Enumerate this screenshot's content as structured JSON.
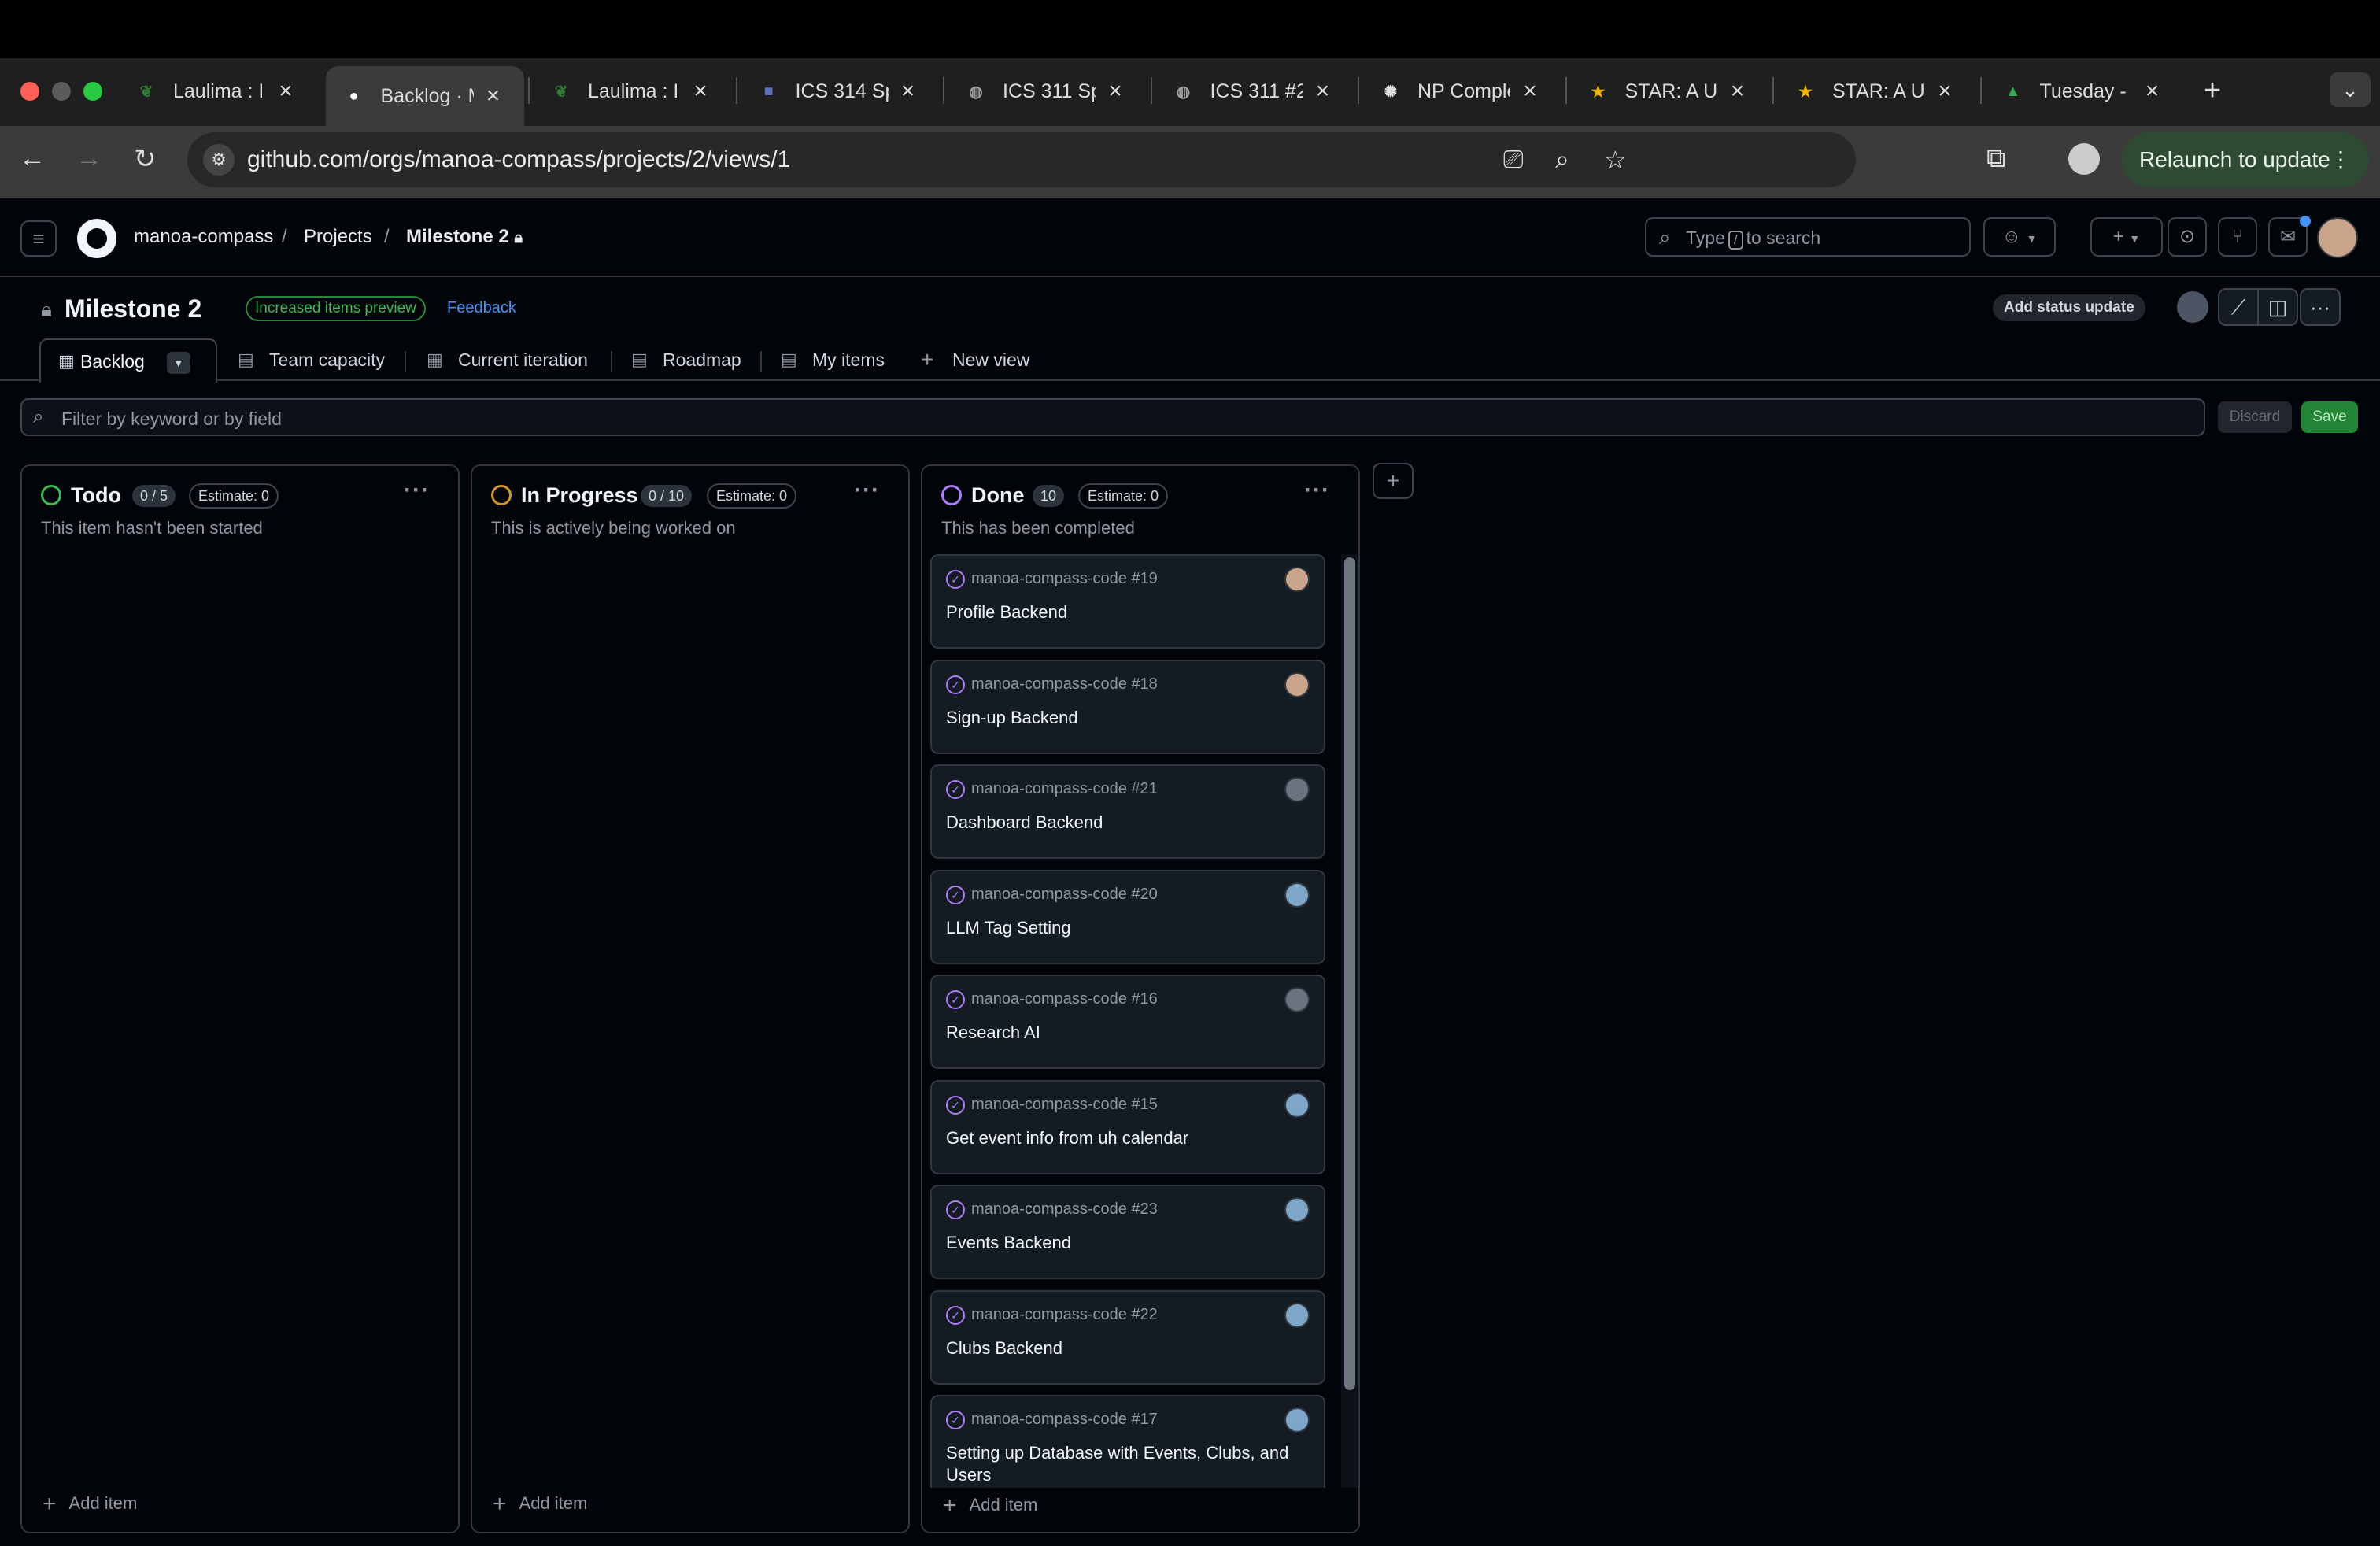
{
  "browser": {
    "tabs": [
      {
        "title": "Laulima : I",
        "favicon": "laulima-leaf-icon",
        "color": "#2e7d32"
      },
      {
        "title": "Backlog · M",
        "favicon": "github-icon",
        "color": "#ffffff"
      },
      {
        "title": "Laulima : I",
        "favicon": "laulima-leaf-icon",
        "color": "#2e7d32"
      },
      {
        "title": "ICS 314 Sp",
        "favicon": "square-icon",
        "color": "#5b6fb5"
      },
      {
        "title": "ICS 311 Sp",
        "favicon": "globe-icon",
        "color": "#9e9e9e"
      },
      {
        "title": "ICS 311 #2",
        "favicon": "globe-icon",
        "color": "#9e9e9e"
      },
      {
        "title": "NP Comple",
        "favicon": "openai-icon",
        "color": "#e0e0e0"
      },
      {
        "title": "STAR: A U",
        "favicon": "star-icon",
        "color": "#f4b400"
      },
      {
        "title": "STAR: A U",
        "favicon": "star-icon",
        "color": "#f4b400"
      },
      {
        "title": "Tuesday -",
        "favicon": "drive-icon",
        "color": "#34a853"
      }
    ],
    "url": "github.com/orgs/manoa-compass/projects/2/views/1",
    "relaunch_label": "Relaunch to update"
  },
  "github_header": {
    "breadcrumbs": [
      "manoa-compass",
      "Projects",
      "Milestone 2"
    ],
    "search_placeholder_pre": "Type",
    "search_key": "/",
    "search_placeholder_post": "to search"
  },
  "project": {
    "title": "Milestone 2",
    "preview_badge": "Increased items preview",
    "feedback_label": "Feedback",
    "status_button": "Add status update"
  },
  "views": {
    "tabs": [
      {
        "label": "Backlog",
        "icon": "board-icon",
        "active": true
      },
      {
        "label": "Team capacity",
        "icon": "table-icon"
      },
      {
        "label": "Current iteration",
        "icon": "board-icon"
      },
      {
        "label": "Roadmap",
        "icon": "roadmap-icon"
      },
      {
        "label": "My items",
        "icon": "table-icon"
      },
      {
        "label": "New view",
        "icon": "plus-icon"
      }
    ]
  },
  "filter": {
    "placeholder": "Filter by keyword or by field",
    "discard_label": "Discard",
    "save_label": "Save"
  },
  "columns": [
    {
      "name": "Todo",
      "count": "0 / 5",
      "estimate": "Estimate: 0",
      "description": "This item hasn't been started",
      "ring_color": "#3fb950",
      "add_label": "Add item",
      "cards": []
    },
    {
      "name": "In Progress",
      "count": "0 / 10",
      "estimate": "Estimate: 0",
      "description": "This is actively being worked on",
      "ring_color": "#d29922",
      "add_label": "Add item",
      "cards": []
    },
    {
      "name": "Done",
      "count": "10",
      "estimate": "Estimate: 0",
      "description": "This has been completed",
      "ring_color": "#ab7df8",
      "add_label": "Add item",
      "cards": [
        {
          "repo": "manoa-compass-code #19",
          "title": "Profile Backend",
          "avatar_color": "#c9a38a"
        },
        {
          "repo": "manoa-compass-code #18",
          "title": "Sign-up Backend",
          "avatar_color": "#c9a38a"
        },
        {
          "repo": "manoa-compass-code #21",
          "title": "Dashboard Backend",
          "avatar_color": "#6b7280"
        },
        {
          "repo": "manoa-compass-code #20",
          "title": "LLM Tag Setting",
          "avatar_color": "#7ea6c9"
        },
        {
          "repo": "manoa-compass-code #16",
          "title": "Research AI",
          "avatar_color": "#6b7280"
        },
        {
          "repo": "manoa-compass-code #15",
          "title": "Get event info from uh calendar",
          "avatar_color": "#7ea6c9"
        },
        {
          "repo": "manoa-compass-code #23",
          "title": "Events Backend",
          "avatar_color": "#7ea6c9"
        },
        {
          "repo": "manoa-compass-code #22",
          "title": "Clubs Backend",
          "avatar_color": "#7ea6c9"
        },
        {
          "repo": "manoa-compass-code #17",
          "title": "Setting up Database with Events, Clubs, and Users",
          "avatar_color": "#7ea6c9"
        }
      ]
    }
  ]
}
